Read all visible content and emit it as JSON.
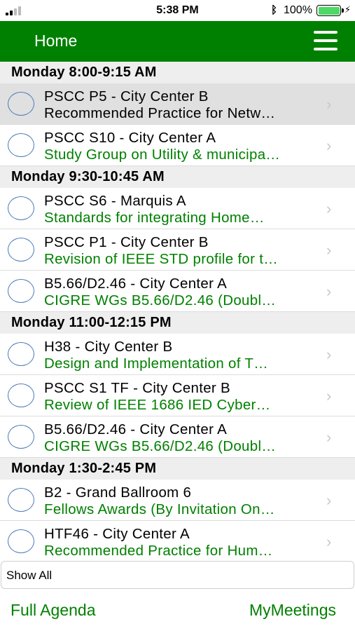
{
  "status_bar": {
    "time": "5:38 PM",
    "battery": "100%",
    "bluetooth_glyph": "ᛒ",
    "bolt_glyph": "⚡"
  },
  "nav": {
    "title": "Home",
    "menu_icon": "hamburger-menu-icon"
  },
  "sections": [
    {
      "header": "Monday 8:00-9:15 AM",
      "items": [
        {
          "title": "PSCC P5 - City Center B",
          "subtitle": "Recommended Practice for Netw…",
          "selected": true
        },
        {
          "title": "PSCC S10 - City Center A",
          "subtitle": "Study Group on Utility & municipa…",
          "selected": false
        }
      ]
    },
    {
      "header": "Monday 9:30-10:45 AM",
      "items": [
        {
          "title": "PSCC S6 - Marquis A",
          "subtitle": "Standards for integrating Home…",
          "selected": false
        },
        {
          "title": "PSCC P1 - City Center B",
          "subtitle": "Revision of IEEE STD profile for t…",
          "selected": false
        },
        {
          "title": "B5.66/D2.46 - City Center A",
          "subtitle": "CIGRE WGs B5.66/D2.46 (Doubl…",
          "selected": false
        }
      ]
    },
    {
      "header": "Monday 11:00-12:15 PM",
      "items": [
        {
          "title": "H38 - City Center B",
          "subtitle": "Design and Implementation of T…",
          "selected": false
        },
        {
          "title": "PSCC S1 TF - City Center B",
          "subtitle": "Review of IEEE 1686 IED Cyber…",
          "selected": false
        },
        {
          "title": "B5.66/D2.46 - City Center A",
          "subtitle": "CIGRE WGs B5.66/D2.46 (Doubl…",
          "selected": false
        }
      ]
    },
    {
      "header": "Monday 1:30-2:45 PM",
      "items": [
        {
          "title": "B2 - Grand Ballroom 6",
          "subtitle": "Fellows Awards (By Invitation On…",
          "selected": false
        },
        {
          "title": "HTF46 - City Center A",
          "subtitle": "Recommended Practice for Hum…",
          "selected": false
        }
      ]
    }
  ],
  "chevron_glyph": "›",
  "show_all": {
    "label": "Show All"
  },
  "bottom": {
    "full_agenda": "Full Agenda",
    "my_meetings": "MyMeetings"
  },
  "colors": {
    "brand_green": "#008000",
    "section_bg": "#eeeeee",
    "selected_row_bg": "#e0e0e0"
  }
}
